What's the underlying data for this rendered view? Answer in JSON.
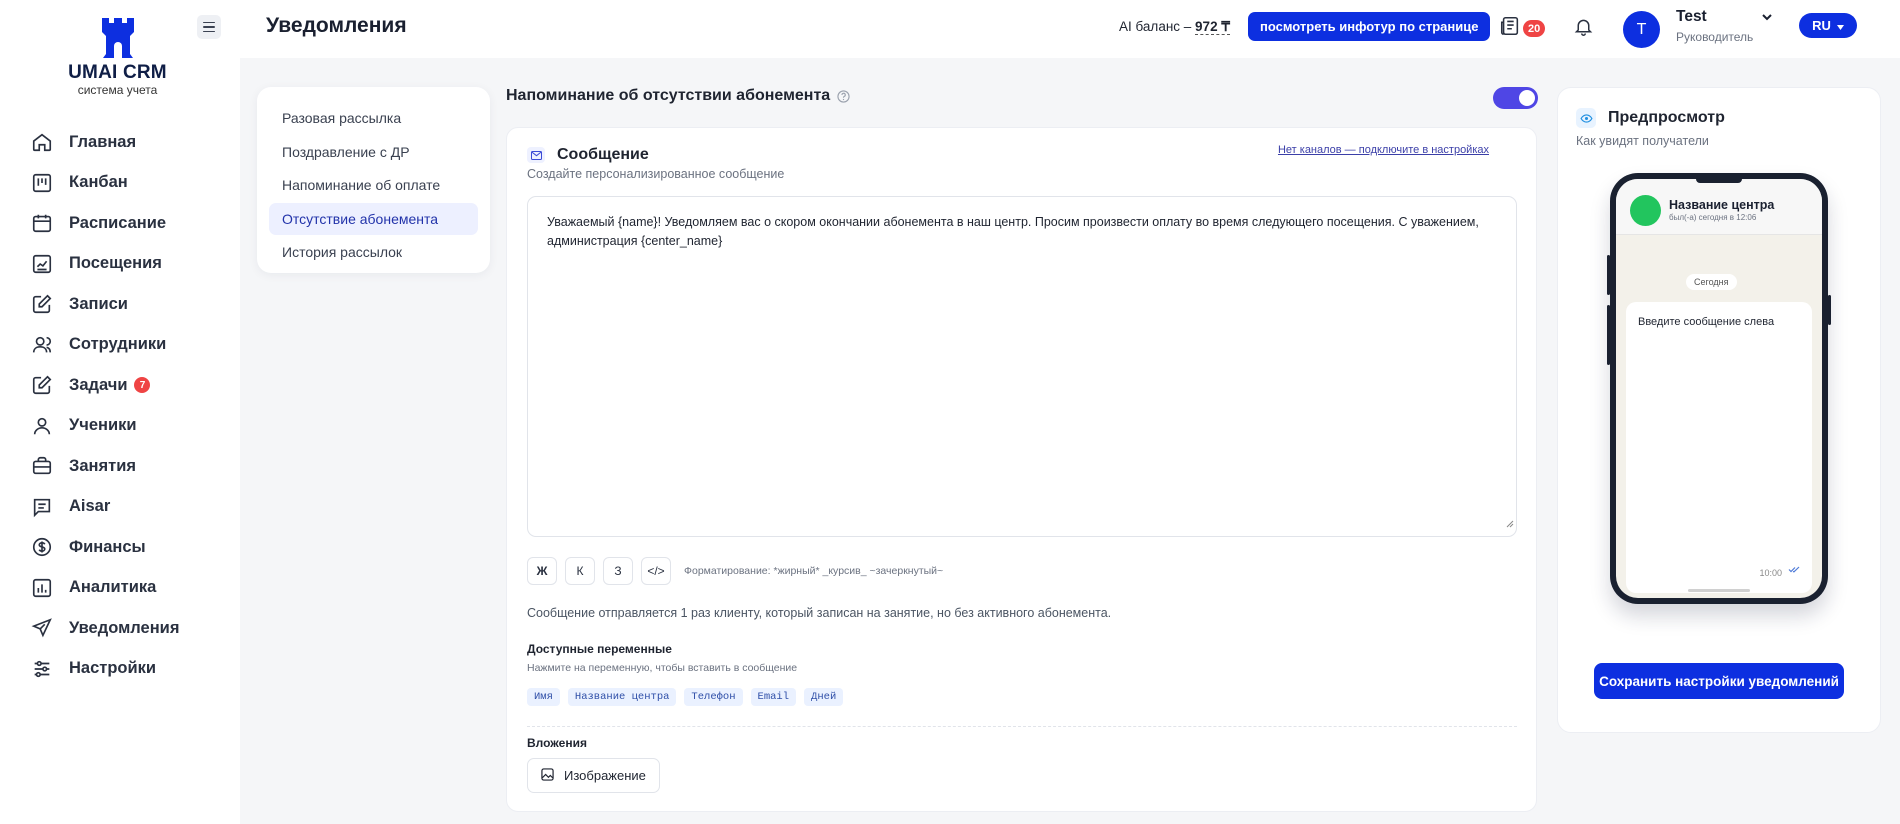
{
  "brand": {
    "name": "UMAI CRM",
    "tagline": "система учета"
  },
  "sidebar": {
    "items": [
      {
        "label": "Главная",
        "icon": "home-icon"
      },
      {
        "label": "Канбан",
        "icon": "kanban-icon"
      },
      {
        "label": "Расписание",
        "icon": "calendar-icon"
      },
      {
        "label": "Посещения",
        "icon": "attendance-icon"
      },
      {
        "label": "Записи",
        "icon": "edit-icon"
      },
      {
        "label": "Сотрудники",
        "icon": "staff-icon"
      },
      {
        "label": "Задачи",
        "icon": "tasks-icon",
        "badge": "7"
      },
      {
        "label": "Ученики",
        "icon": "student-icon"
      },
      {
        "label": "Занятия",
        "icon": "briefcase-icon"
      },
      {
        "label": "Aisar",
        "icon": "chat-list-icon"
      },
      {
        "label": "Финансы",
        "icon": "dollar-icon"
      },
      {
        "label": "Аналитика",
        "icon": "analytics-icon"
      },
      {
        "label": "Уведомления",
        "icon": "send-icon"
      },
      {
        "label": "Настройки",
        "icon": "sliders-icon"
      }
    ]
  },
  "header": {
    "title": "Уведомления",
    "ai_balance_label": "AI баланс – ",
    "ai_balance_value": "972 ₸",
    "infotour_button": "посмотреть инфотур по странице",
    "news_count": "20",
    "user_initial": "T",
    "user_name": "Test",
    "user_role": "Руководитель",
    "lang": "RU"
  },
  "submenu": {
    "items": [
      {
        "label": "Разовая рассылка",
        "active": false
      },
      {
        "label": "Поздравление с ДР",
        "active": false
      },
      {
        "label": "Напоминание об оплате",
        "active": false
      },
      {
        "label": "Отсутствие абонемента",
        "active": true
      },
      {
        "label": "История рассылок",
        "active": false
      }
    ]
  },
  "section": {
    "title": "Напоминание об отсутствии абонемента",
    "enabled": true
  },
  "message_card": {
    "title": "Сообщение",
    "subtitle": "Создайте персонализированное сообщение",
    "channels_link": "Нет каналов — подключите в настройках",
    "text": "Уважаемый {name}! Уведомляем вас о скором окончании абонемента в наш центр. Просим произвести оплату во время следующего посещения. С уважением, администрация {center_name}",
    "format_buttons": [
      "Ж",
      "К",
      "З",
      "</>"
    ],
    "format_hint": "Форматирование: *жирный* _курсив_ ~зачеркнутый~",
    "send_info": "Сообщение отправляется 1 раз клиенту, который записан на занятие, но без активного абонемента.",
    "vars_title": "Доступные переменные",
    "vars_subtitle": "Нажмите на переменную, чтобы вставить в сообщение",
    "variables": [
      "Имя",
      "Название центра",
      "Телефон",
      "Email",
      "Дней"
    ],
    "attachments_title": "Вложения",
    "image_button": "Изображение"
  },
  "preview": {
    "title": "Предпросмотр",
    "subtitle": "Как увидят получатели",
    "chat_name": "Название центра",
    "chat_status": "был(-а) сегодня в 12:06",
    "day_label": "Сегодня",
    "bubble_text": "Введите сообщение слева",
    "bubble_time": "10:00",
    "save_button": "Сохранить настройки уведомлений"
  },
  "colors": {
    "primary": "#0d2fe0",
    "toggle": "#4f46e5",
    "badge": "#ef4444",
    "chat_avatar": "#22c55e"
  }
}
